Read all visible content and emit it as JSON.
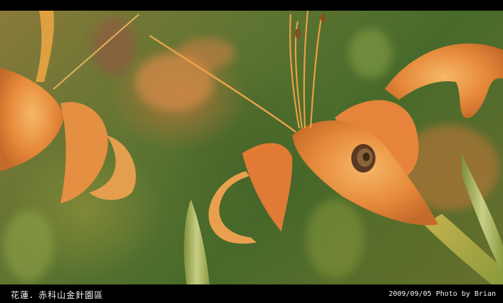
{
  "caption": {
    "title": "花蓮．赤科山金針園區",
    "credit": "2009/09/05 Photo by Brian"
  },
  "colors": {
    "frame": "#000000",
    "petal_orange": "#e08a3c",
    "petal_highlight": "#f4b56a",
    "foliage_green": "#4c6e2c",
    "bud_green": "#8fa247"
  },
  "photo": {
    "subjects": [
      "daylily-flower-right",
      "daylily-flower-left",
      "flower-bud",
      "snail-shell",
      "stamens"
    ]
  }
}
